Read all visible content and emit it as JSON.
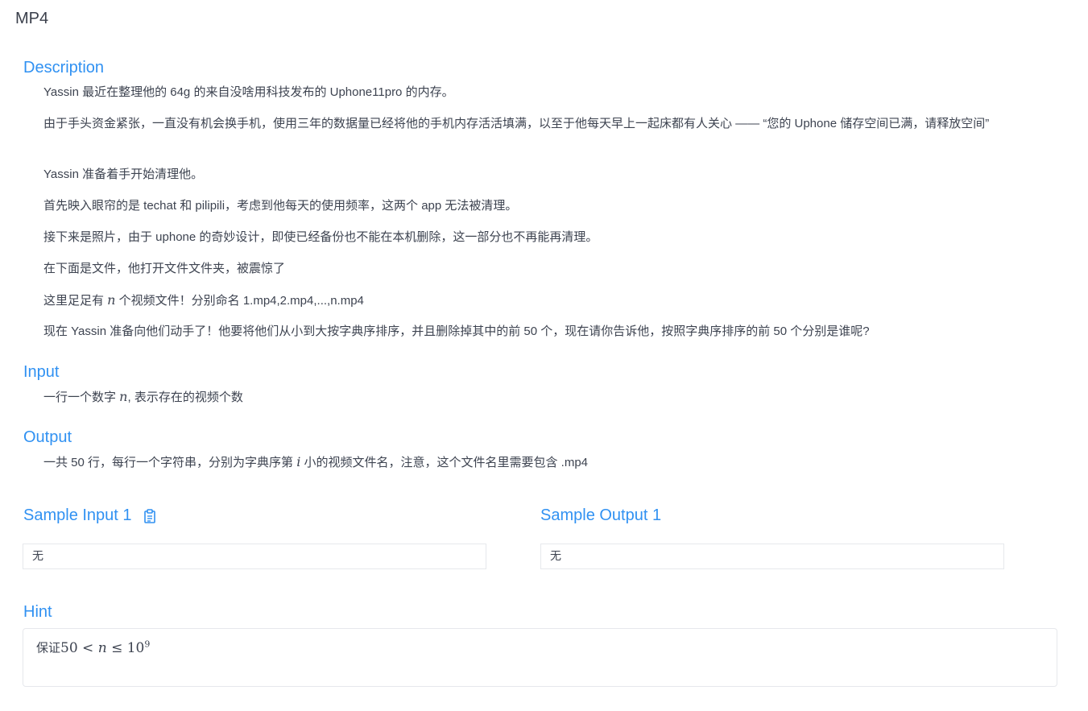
{
  "problem": {
    "title": "MP4"
  },
  "description": {
    "heading": "Description",
    "paragraphs": {
      "p1": "Yassin 最近在整理他的 64g 的来自没啥用科技发布的 Uphone11pro 的内存。",
      "p2": "由于手头资金紧张，一直没有机会换手机，使用三年的数据量已经将他的手机内存活活填满，以至于他每天早上一起床都有人关心 —— “您的 Uphone 储存空间已满，请释放空间”",
      "p3": "Yassin 准备着手开始清理他。",
      "p4": "首先映入眼帘的是 techat 和 pilipili，考虑到他每天的使用频率，这两个 app 无法被清理。",
      "p5": "接下来是照片，由于 uphone 的奇妙设计，即使已经备份也不能在本机删除，这一部分也不再能再清理。",
      "p6": "在下面是文件，他打开文件文件夹，被震惊了",
      "p7_before": "这里足足有 ",
      "p7_var": "n",
      "p7_after": " 个视频文件！分别命名 1.mp4,2.mp4,...,n.mp4",
      "p8": "现在 Yassin 准备向他们动手了！他要将他们从小到大按字典序排序，并且删除掉其中的前 50 个，现在请你告诉他，按照字典序排序的前 50 个分别是谁呢?"
    }
  },
  "input": {
    "heading": "Input",
    "text_before": "一行一个数字 ",
    "var": "n",
    "text_after": ", 表示存在的视频个数"
  },
  "output": {
    "heading": "Output",
    "text_before": "一共 50 行，每行一个字符串，分别为字典序第 ",
    "var": "i",
    "text_after": " 小的视频文件名，注意，这个文件名里需要包含 .mp4"
  },
  "samples": {
    "input_heading": "Sample Input 1",
    "input_value": "无",
    "output_heading": "Sample Output 1",
    "output_value": "无",
    "copy_icon": "clipboard-icon"
  },
  "hint": {
    "heading": "Hint",
    "text": "保证",
    "math_low": "50",
    "math_lt": " < ",
    "math_var": "n",
    "math_le": " ≤ ",
    "math_base": "10",
    "math_exp": "9"
  },
  "colors": {
    "heading": "#3091f2",
    "text": "#3d4350",
    "border": "#e6e8ec"
  }
}
